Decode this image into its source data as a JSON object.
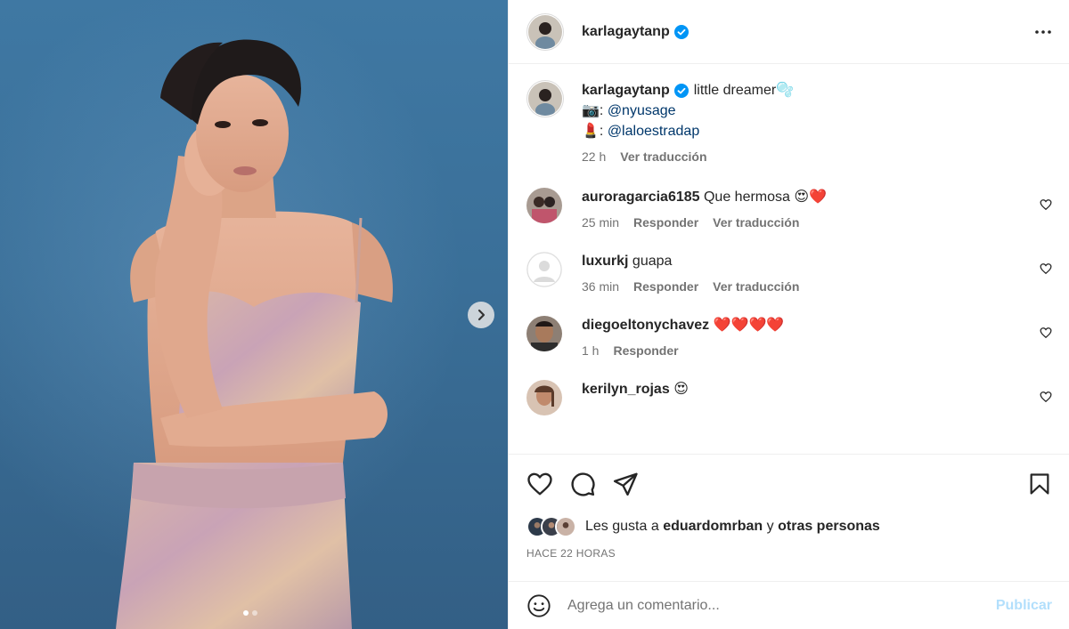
{
  "header": {
    "username": "karlagaytanp",
    "verified": true,
    "more_icon": "more-horizontal-icon"
  },
  "caption": {
    "username": "karlagaytanp",
    "text": "little dreamer🫧",
    "line2_emoji": "📷",
    "line2_mention": "@nyusage",
    "line3_emoji": "💄",
    "line3_mention": "@laloestradap",
    "time": "22 h",
    "translate": "Ver traducción"
  },
  "comments": [
    {
      "username": "auroragarcia6185",
      "text": "Que hermosa 😍❤️",
      "time": "25 min",
      "reply": "Responder",
      "translate": "Ver traducción"
    },
    {
      "username": "luxurkj",
      "text": "guapa",
      "time": "36 min",
      "reply": "Responder",
      "translate": "Ver traducción"
    },
    {
      "username": "diegoeltonychavez",
      "text": "❤️❤️❤️❤️",
      "time": "1 h",
      "reply": "Responder",
      "translate": ""
    },
    {
      "username": "kerilyn_rojas",
      "text": "😍",
      "time": "",
      "reply": "",
      "translate": ""
    }
  ],
  "likes": {
    "prefix": "Les gusta a",
    "user": "eduardomrban",
    "joiner": "y",
    "others": "otras personas"
  },
  "timestamp": "HACE 22 HORAS",
  "composer": {
    "placeholder": "Agrega un comentario...",
    "publish": "Publicar"
  },
  "carousel": {
    "current": 1,
    "total": 2
  },
  "colors": {
    "link": "#00376b",
    "verified": "#0095f6",
    "publish_disabled": "#b2dffc",
    "heart_red": "#ed4956"
  }
}
